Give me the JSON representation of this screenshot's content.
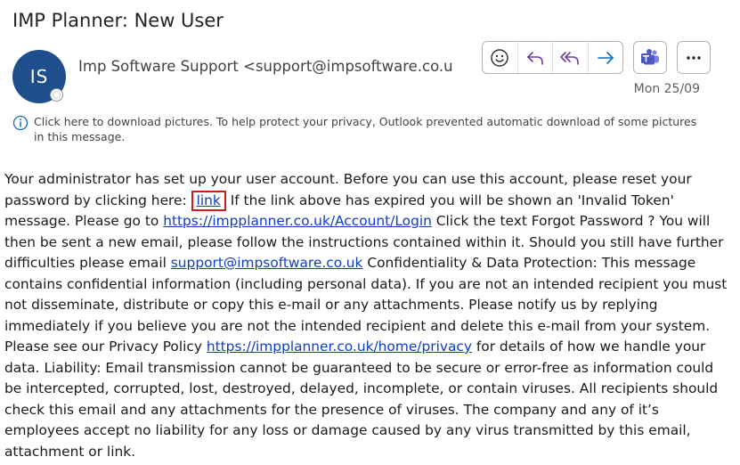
{
  "subject": "IMP Planner: New User",
  "sender": {
    "initials": "IS",
    "display": "Imp Software Support <support@impsoftware.co.uk"
  },
  "actions": {
    "emoji_icon": "emoji-icon",
    "reply_icon": "reply-icon",
    "reply_all_icon": "reply-all-icon",
    "forward_icon": "forward-icon",
    "teams_icon": "teams-icon",
    "more_icon": "more-icon"
  },
  "date": "Mon 25/09",
  "info_bar": {
    "text": "Click here to download pictures. To help protect your privacy, Outlook prevented automatic download of some pictures in this message."
  },
  "body": {
    "p1": "Your administrator has set up your user account. Before you can use this account, please reset your password by clicking here: ",
    "link1": "link",
    "p2": " If the link above has expired you will be shown an 'Invalid Token' message. Please go to ",
    "link2": "https://impplanner.co.uk/Account/Login",
    "p3": " Click the text Forgot Password ? You will then be sent a new email, please follow the instructions contained within it. Should you still have further difficulties please email ",
    "link3": "support@impsoftware.co.uk",
    "p4": " Confidentiality & Data Protection: This message contains confidential information (including personal data). If you are not an intended recipient you must not disseminate, distribute or copy this e-mail or any attachments. Please notify us by replying immediately if you believe you are not the intended recipient and delete this e-mail from your system. Please see our Privacy Policy ",
    "link4": "https://impplanner.co.uk/home/privacy",
    "p5": " for details of how we handle your data. Liability: Email transmission cannot be guaranteed to be secure or error-free as information could be intercepted, corrupted, lost, destroyed, delayed, incomplete, or contain viruses. All recipients should check this email and any attachments for the presence of viruses. The company and any of it’s employees accept no liability for any loss or damage caused by any virus transmitted by this email, attachment or link."
  },
  "colors": {
    "avatar": "#1e4e8c",
    "link": "#0f3ec2",
    "highlight_box": "#d11a1a",
    "action_icons": "#6b3fa0",
    "forward_icon": "#0f6cbd",
    "teams": "#4b53bc"
  }
}
